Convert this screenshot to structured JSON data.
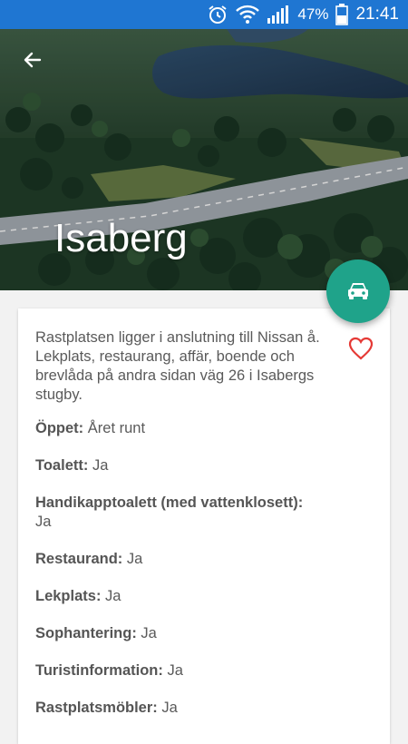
{
  "status_bar": {
    "icons": [
      "alarm-icon",
      "wifi-icon",
      "signal-icon",
      "battery-icon"
    ],
    "battery": "47%",
    "time": "21:41",
    "color": "#1f76d2"
  },
  "header": {
    "title": "Isaberg",
    "back_icon": "back-arrow-icon"
  },
  "fab": {
    "icon": "car-icon",
    "color": "#1fa38a"
  },
  "card": {
    "favorite_icon": "heart-outline-icon",
    "favorite_color": "#e53935",
    "description": "Rastplatsen ligger i anslutning till Nissan å. Lekplats, restaurang, affär, boende och brevlåda på andra sidan väg 26 i Isabergs stugby.",
    "facts": [
      {
        "label": "Öppet:",
        "value": "Året runt"
      },
      {
        "label": "Toalett:",
        "value": "Ja"
      },
      {
        "label": "Handikapptoalett (med vattenklosett):",
        "value": "Ja"
      },
      {
        "label": "Restaurand:",
        "value": "Ja"
      },
      {
        "label": "Lekplats:",
        "value": "Ja"
      },
      {
        "label": "Sophantering:",
        "value": "Ja"
      },
      {
        "label": "Turistinformation:",
        "value": "Ja"
      },
      {
        "label": "Rastplatsmöbler:",
        "value": "Ja"
      }
    ]
  }
}
